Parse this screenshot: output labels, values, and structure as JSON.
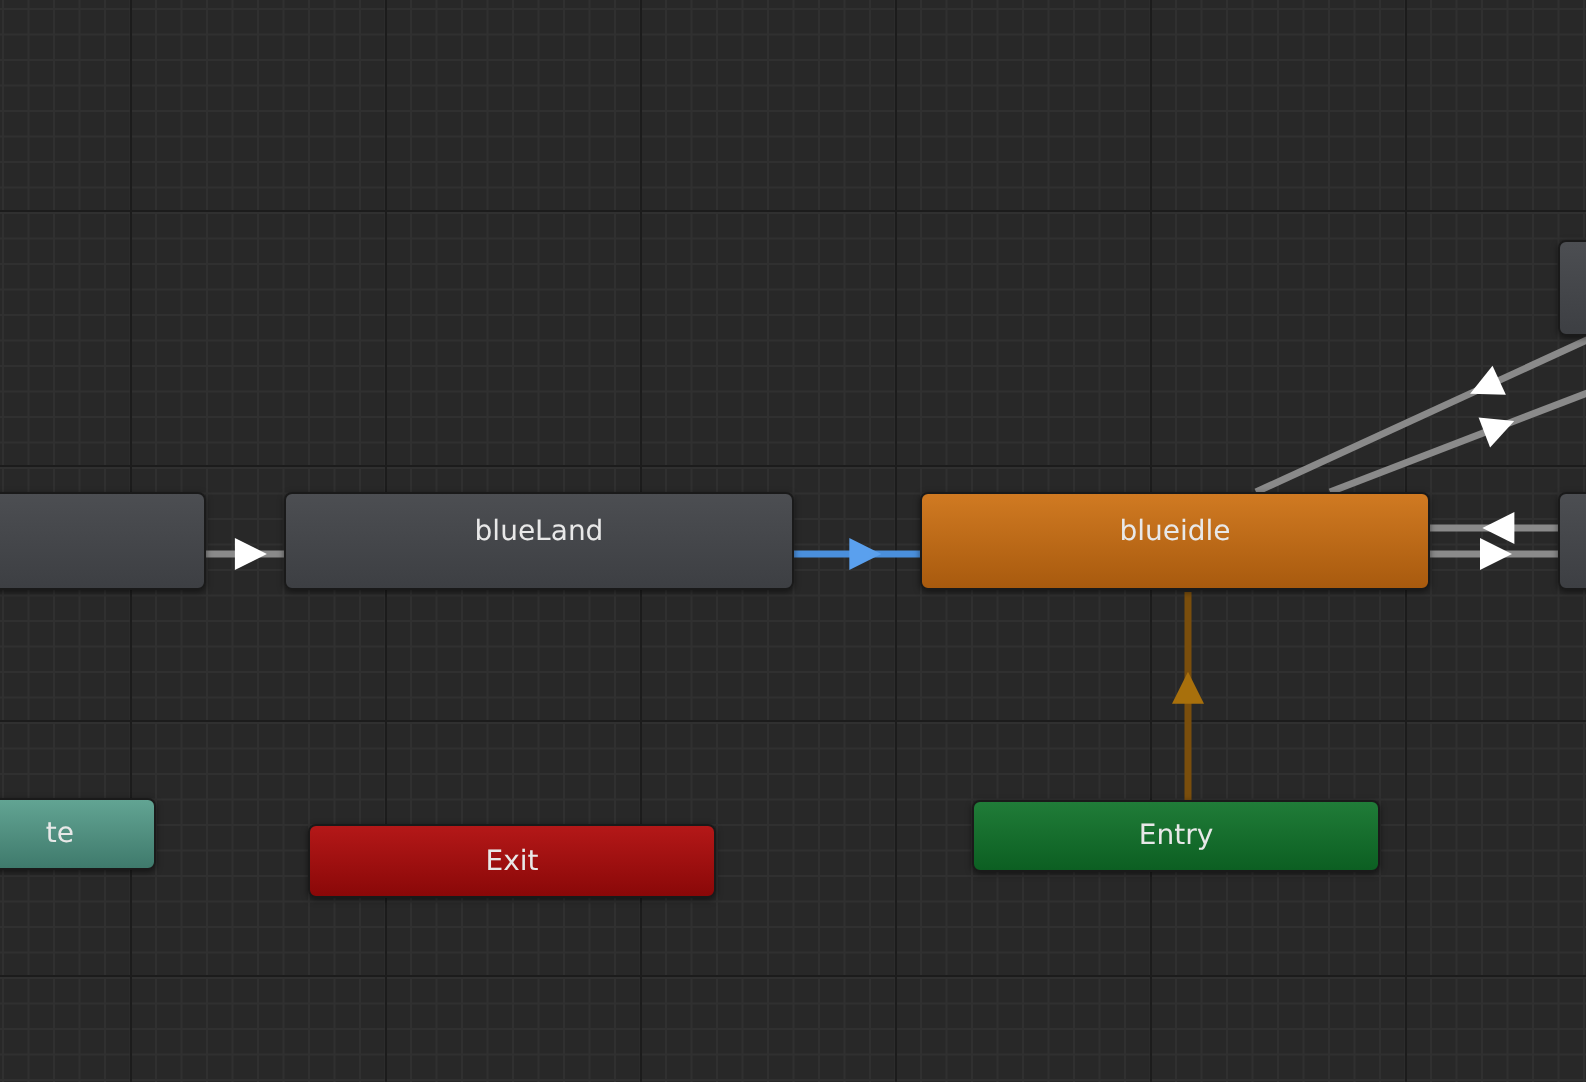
{
  "nodes": [
    {
      "kind": "state"
    },
    {
      "kind": "state",
      "label": "blueLand"
    },
    {
      "kind": "default",
      "label": "blueidle"
    },
    {
      "kind": "entry",
      "label": "Entry"
    },
    {
      "kind": "exit",
      "label": "Exit"
    },
    {
      "kind": "any",
      "label": "te"
    },
    {
      "kind": "state"
    },
    {
      "kind": "state"
    }
  ],
  "transitions": [
    {
      "kind": "normal",
      "selected": false
    },
    {
      "kind": "normal",
      "selected": true
    },
    {
      "kind": "entry",
      "selected": false
    },
    {
      "kind": "normal",
      "selected": false
    },
    {
      "kind": "normal",
      "selected": false
    },
    {
      "kind": "normal",
      "selected": false
    },
    {
      "kind": "normal",
      "selected": false
    }
  ]
}
